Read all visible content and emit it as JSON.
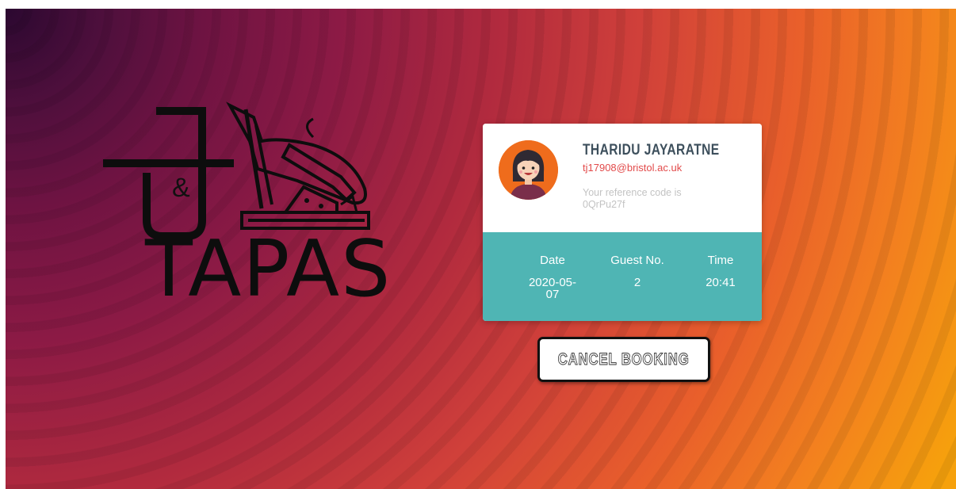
{
  "logo": {
    "amp": "&",
    "text": "TAPAS"
  },
  "booking": {
    "name": "THARIDU JAYARATNE",
    "email": "tj17908@bristol.ac.uk",
    "reference": "Your reference code is 0QrPu27f",
    "date_label": "Date",
    "date_value": "2020-05-07",
    "guests_label": "Guest No.",
    "guests_value": "2",
    "time_label": "Time",
    "time_value": "20:41"
  },
  "actions": {
    "cancel_label": "CANCEL BOOKING"
  },
  "colors": {
    "accent_teal": "#4fb5b4",
    "email_red": "#e24a4a",
    "avatar_orange": "#ef6c1c"
  }
}
